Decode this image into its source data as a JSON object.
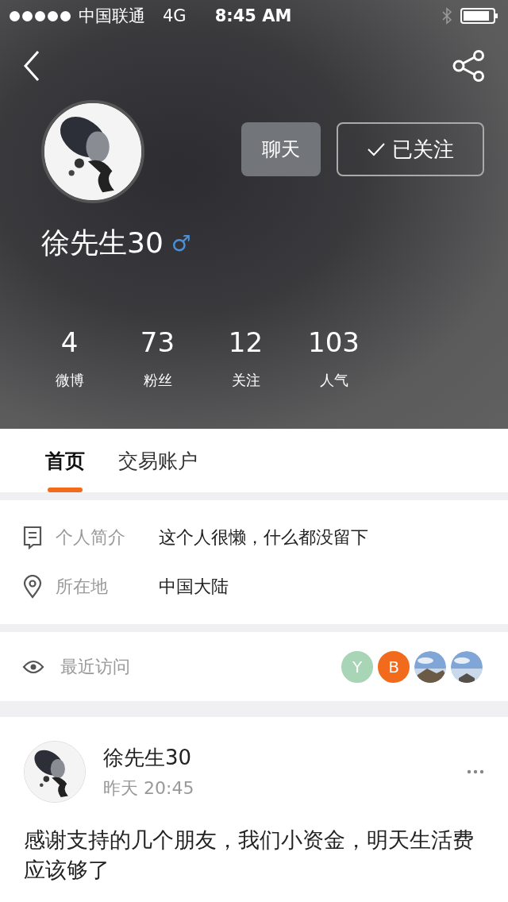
{
  "status_bar": {
    "carrier": "中国联通",
    "network": "4G",
    "time": "8:45 AM"
  },
  "profile": {
    "name": "徐先生30",
    "gender": "♂",
    "buttons": [
      {
        "kind": "chat",
        "label": "聊天"
      },
      {
        "kind": "followed",
        "label": "已关注"
      }
    ],
    "stats": [
      {
        "value": "4",
        "label": "微博"
      },
      {
        "value": "73",
        "label": "粉丝"
      },
      {
        "value": "12",
        "label": "关注"
      },
      {
        "value": "103",
        "label": "人气"
      }
    ]
  },
  "tabs": [
    {
      "label": "首页",
      "selected": true
    },
    {
      "label": "交易账户",
      "selected": false
    }
  ],
  "info": [
    {
      "kind": "bio",
      "label": "个人简介",
      "value": "这个人很懒，什么都没留下"
    },
    {
      "kind": "location",
      "label": "所在地",
      "value": "中国大陆"
    }
  ],
  "visitors": {
    "label": "最近访问",
    "avatars": [
      {
        "kind": "letter",
        "text": "Y",
        "color": "#a8d5b5"
      },
      {
        "kind": "letter",
        "text": "B",
        "color": "#f26a1b"
      },
      {
        "kind": "picture"
      },
      {
        "kind": "picture"
      }
    ]
  },
  "post": {
    "author": "徐先生30",
    "time": "昨天 20:45",
    "text": "感谢支持的几个朋友，我们小资金，明天生活费应该够了"
  }
}
